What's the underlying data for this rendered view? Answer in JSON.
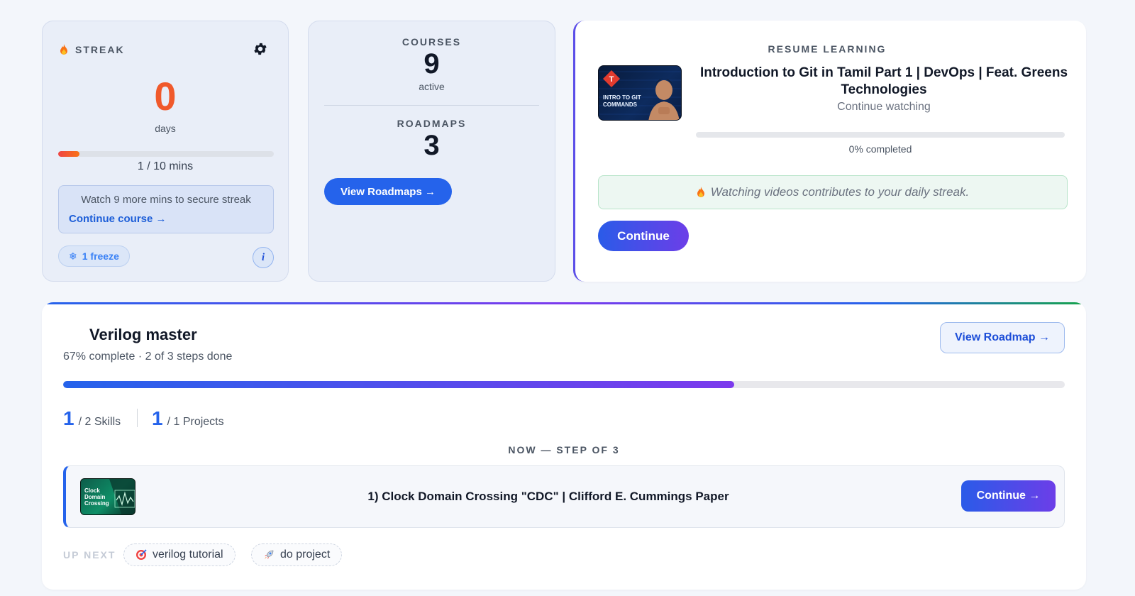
{
  "streak": {
    "label": "STREAK",
    "count": "0",
    "unit": "days",
    "progress_fraction": 0.1,
    "minutes": "1 / 10 mins",
    "message": "Watch 9 more mins to secure streak",
    "link": "Continue course →",
    "freeze": "1 freeze",
    "info": "i"
  },
  "stats": {
    "courses_label": "COURSES",
    "courses_count": "9",
    "courses_sub": "active",
    "roadmaps_label": "ROADMAPS",
    "roadmaps_count": "3",
    "button": "View Roadmaps →"
  },
  "resume": {
    "label": "RESUME LEARNING",
    "title": "Introduction to Git in Tamil Part 1 | DevOps | Feat. Greens Technologies",
    "subtitle": "Continue watching",
    "progress_fraction": 0,
    "percent_text": "0% completed",
    "note": "Watching videos contributes to your daily streak.",
    "button": "Continue",
    "thumbnail_text": "INTRO TO GIT COMMANDS"
  },
  "roadmap": {
    "title": "Verilog master",
    "subtitle": "67% complete · 2 of 3 steps done",
    "progress_fraction": 0.67,
    "view_button": "View Roadmap →",
    "skills_num": "1",
    "skills_label": "/ 2 Skills",
    "projects_num": "1",
    "projects_label": "/ 1 Projects",
    "step_label": "NOW — STEP OF 3",
    "step_title": "1) Clock Domain Crossing \"CDC\" | Clifford E. Cummings Paper",
    "step_button": "Continue →",
    "step_thumbnail_text": "Clock Domain Crossing",
    "up_next_label": "UP NEXT",
    "up_next": [
      {
        "icon": "target-icon",
        "label": "verilog tutorial"
      },
      {
        "icon": "rocket-icon",
        "label": "do project"
      }
    ]
  },
  "colors": {
    "accent": "#2563eb",
    "streak_orange": "#f0592b",
    "purple": "#7c3aed",
    "success_bg": "#edf7f2"
  }
}
